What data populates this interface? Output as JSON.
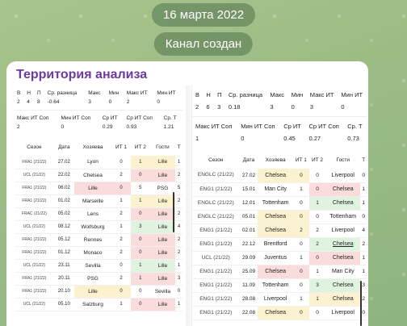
{
  "header": {
    "date": "16 марта 2022",
    "status": "Канал создан"
  },
  "title": "Территория анализа",
  "left": {
    "stats1": {
      "headers": [
        "В",
        "Н",
        "П",
        "Ср. разница",
        "Макс",
        "Мин",
        "Макс ИТ",
        "Мин ИТ"
      ],
      "values": [
        "2",
        "4",
        "8",
        "-0.64",
        "3",
        "0",
        "2",
        "0"
      ]
    },
    "stats2": {
      "headers": [
        "Макс ИТ Соп",
        "Мин ИТ Соп",
        "Ср ИТ",
        "Ср ИТ Соп",
        "Ср. Т"
      ],
      "values": [
        "2",
        "0",
        "0.29",
        "0.93",
        "1.21"
      ]
    },
    "columns": [
      "Сезон",
      "Дата",
      "Хозяева",
      "ИТ 1",
      "ИТ 2",
      "Гости",
      "Т"
    ],
    "rows": [
      {
        "s": "FRA1 (21/22)",
        "d": "27.02",
        "h": "Lyon",
        "i1": "0",
        "i2": "1",
        "a": "Lille",
        "t": "1",
        "hc": "",
        "ac": "y"
      },
      {
        "s": "UCL (21/22)",
        "d": "22.02",
        "h": "Chelsea",
        "i1": "2",
        "i2": "0",
        "a": "Lille",
        "t": "2",
        "hc": "",
        "ac": "r"
      },
      {
        "s": "FRA1 (21/22)",
        "d": "06.02",
        "h": "Lille",
        "i1": "0",
        "i2": "5",
        "a": "PSG",
        "t": "5",
        "hc": "r",
        "ac": ""
      },
      {
        "s": "FRA1 (21/22)",
        "d": "01.02",
        "h": "Marseille",
        "i1": "1",
        "i2": "1",
        "a": "Lille",
        "t": "2",
        "hc": "",
        "ac": "y"
      },
      {
        "s": "FRAC (21/22)",
        "d": "05.02",
        "h": "Lens",
        "i1": "2",
        "i2": "0",
        "a": "Lille",
        "t": "2",
        "hc": "",
        "ac": "r"
      },
      {
        "s": "UCL (21/22)",
        "d": "08.12",
        "h": "Wolfsburg",
        "i1": "1",
        "i2": "3",
        "a": "Lille",
        "t": "4",
        "hc": "",
        "ac": "g"
      },
      {
        "s": "FRA1 (21/22)",
        "d": "05.12",
        "h": "Rennes",
        "i1": "2",
        "i2": "0",
        "a": "Lille",
        "t": "2",
        "hc": "",
        "ac": "r"
      },
      {
        "s": "FRA1 (21/22)",
        "d": "01.12",
        "h": "Monaco",
        "i1": "2",
        "i2": "0",
        "a": "Lille",
        "t": "2",
        "hc": "",
        "ac": "r"
      },
      {
        "s": "UCL (21/22)",
        "d": "23.11",
        "h": "Sevilla",
        "i1": "0",
        "i2": "1",
        "a": "Lille",
        "t": "1",
        "hc": "",
        "ac": "g"
      },
      {
        "s": "FRA1 (21/22)",
        "d": "20.11",
        "h": "PSG",
        "i1": "2",
        "i2": "1",
        "a": "Lille",
        "t": "3",
        "hc": "",
        "ac": "r"
      },
      {
        "s": "FRA1 (21/22)",
        "d": "20.10",
        "h": "Lille",
        "i1": "0",
        "i2": "0",
        "a": "Sevilla",
        "t": "0",
        "hc": "y",
        "ac": ""
      },
      {
        "s": "UCL (21/22)",
        "d": "05.10",
        "h": "Salzburg",
        "i1": "1",
        "i2": "0",
        "a": "Lille",
        "t": "1",
        "hc": "",
        "ac": "r"
      }
    ]
  },
  "right": {
    "stats1": {
      "headers": [
        "В",
        "Н",
        "П",
        "Ср. разница",
        "Макс",
        "Мин",
        "Макс ИТ",
        "Мин ИТ"
      ],
      "values": [
        "2",
        "6",
        "3",
        "0.18",
        "3",
        "0",
        "3",
        "0"
      ]
    },
    "stats2": {
      "headers": [
        "Макс ИТ Соп",
        "Мин ИТ Соп",
        "Ср ИТ",
        "Ср ИТ Соп",
        "Ср. Т"
      ],
      "values": [
        "1",
        "0",
        "0.45",
        "0.27",
        "0.73"
      ]
    },
    "columns": [
      "Сезон",
      "Дата",
      "Хозяева",
      "ИТ 1",
      "ИТ 2",
      "Гости",
      "Т"
    ],
    "rows": [
      {
        "s": "ENGLC (21/22)",
        "d": "27.02",
        "h": "Chelsea",
        "i1": "0",
        "i2": "0",
        "a": "Liverpool",
        "t": "0",
        "hc": "y",
        "ac": ""
      },
      {
        "s": "ENG1 (21/22)",
        "d": "15.01",
        "h": "Man City",
        "i1": "1",
        "i2": "0",
        "a": "Chelsea",
        "t": "1",
        "hc": "",
        "ac": "r"
      },
      {
        "s": "ENGLC (21/22)",
        "d": "12.01",
        "h": "Tottenham",
        "i1": "0",
        "i2": "1",
        "a": "Chelsea",
        "t": "1",
        "hc": "",
        "ac": "g"
      },
      {
        "s": "ENGLC (21/22)",
        "d": "05.01",
        "h": "Chelsea",
        "i1": "0",
        "i2": "0",
        "a": "Tottenham",
        "t": "0",
        "hc": "y",
        "ac": ""
      },
      {
        "s": "ENG1 (21/22)",
        "d": "02.01",
        "h": "Chelsea",
        "i1": "2",
        "i2": "2",
        "a": "Liverpool",
        "t": "4",
        "hc": "y",
        "ac": ""
      },
      {
        "s": "ENG1 (21/22)",
        "d": "22.12",
        "h": "Brentford",
        "i1": "0",
        "i2": "2",
        "a": "Chelsea",
        "t": "2",
        "hc": "",
        "ac": "g"
      },
      {
        "s": "UCL (21/22)",
        "d": "29.09",
        "h": "Juventus",
        "i1": "1",
        "i2": "0",
        "a": "Chelsea",
        "t": "1",
        "hc": "",
        "ac": "r"
      },
      {
        "s": "ENG1 (21/22)",
        "d": "25.09",
        "h": "Chelsea",
        "i1": "0",
        "i2": "1",
        "a": "Man City",
        "t": "1",
        "hc": "r",
        "ac": ""
      },
      {
        "s": "ENG1 (21/22)",
        "d": "11.09",
        "h": "Tottenham",
        "i1": "0",
        "i2": "3",
        "a": "Chelsea",
        "t": "3",
        "hc": "",
        "ac": "g"
      },
      {
        "s": "ENG1 (21/22)",
        "d": "28.08",
        "h": "Liverpool",
        "i1": "1",
        "i2": "1",
        "a": "Chelsea",
        "t": "2",
        "hc": "",
        "ac": "y"
      },
      {
        "s": "ENG1 (21/22)",
        "d": "22.08",
        "h": "Chelsea",
        "i1": "0",
        "i2": "0",
        "a": "Liverpool",
        "t": "0",
        "hc": "y",
        "ac": ""
      }
    ]
  }
}
